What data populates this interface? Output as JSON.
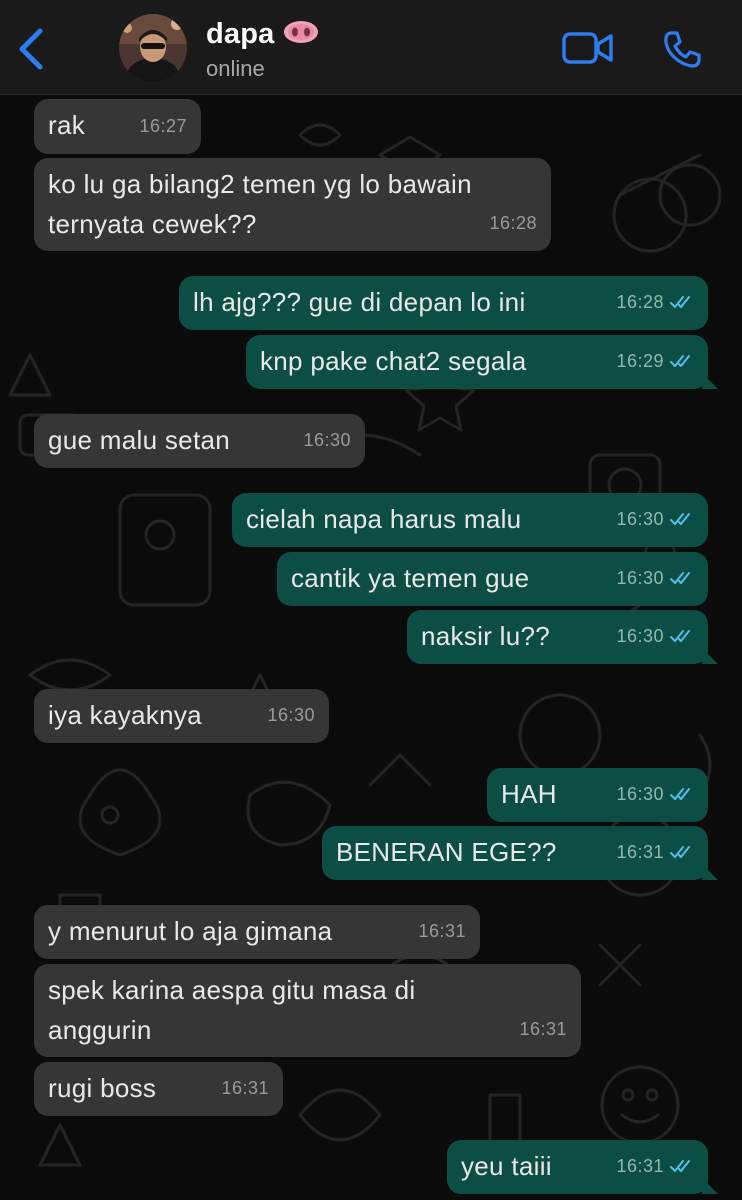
{
  "header": {
    "contact_name": "dapa",
    "status": "online",
    "emoji_icon": "pig-nose-icon",
    "back_icon": "chevron-left-icon",
    "video_icon": "video-camera-icon",
    "call_icon": "phone-icon",
    "accent_color": "#2f7bf0"
  },
  "colors": {
    "incoming_bubble": "#363636",
    "outgoing_bubble": "#0d4e44",
    "read_tick": "#53bdeb"
  },
  "messages": [
    {
      "dir": "in",
      "text": "rak",
      "time": "16:27"
    },
    {
      "dir": "in",
      "text": "ko lu ga bilang2 temen yg lo bawain\nternyata cewek??",
      "time": "16:28"
    },
    {
      "dir": "out",
      "text": "lh ajg??? gue di depan lo ini",
      "time": "16:28",
      "status": "read"
    },
    {
      "dir": "out",
      "text": "knp pake chat2 segala",
      "time": "16:29",
      "status": "read"
    },
    {
      "dir": "in",
      "text": "gue malu setan",
      "time": "16:30"
    },
    {
      "dir": "out",
      "text": "cielah napa harus malu",
      "time": "16:30",
      "status": "read"
    },
    {
      "dir": "out",
      "text": "cantik ya temen gue",
      "time": "16:30",
      "status": "read"
    },
    {
      "dir": "out",
      "text": "naksir lu??",
      "time": "16:30",
      "status": "read"
    },
    {
      "dir": "in",
      "text": "iya kayaknya",
      "time": "16:30"
    },
    {
      "dir": "out",
      "text": "HAH",
      "time": "16:30",
      "status": "read"
    },
    {
      "dir": "out",
      "text": "BENERAN EGE??",
      "time": "16:31",
      "status": "read"
    },
    {
      "dir": "in",
      "text": "y menurut lo aja gimana",
      "time": "16:31"
    },
    {
      "dir": "in",
      "text": "spek karina aespa gitu masa di\nanggurin",
      "time": "16:31"
    },
    {
      "dir": "in",
      "text": "rugi boss",
      "time": "16:31"
    },
    {
      "dir": "out",
      "text": "yeu taiii",
      "time": "16:31",
      "status": "read"
    }
  ]
}
